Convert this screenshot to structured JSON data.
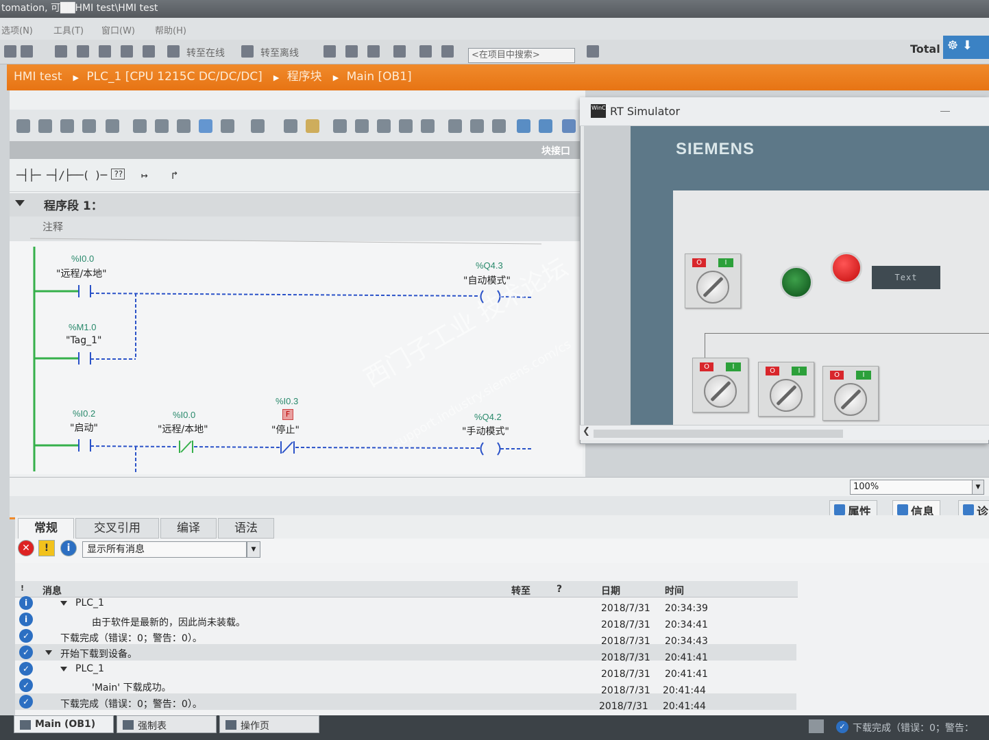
{
  "window": {
    "title": "tomation,  可██HMI test\\HMI test"
  },
  "menu": [
    {
      "label": "选项(N)"
    },
    {
      "label": "工具(T)"
    },
    {
      "label": "窗口(W)"
    },
    {
      "label": "帮助(H)"
    }
  ],
  "toolbar": {
    "go_online": "转至在线",
    "go_offline": "转至离线",
    "search_placeholder": "<在项目中搜索>",
    "total": "Total"
  },
  "breadcrumb": [
    "HMI test",
    "PLC_1 [CPU 1215C DC/DC/DC]",
    "程序块",
    "Main [OB1]"
  ],
  "editor": {
    "interface_label": "块接口",
    "ladder_tools": [
      "─┤├─",
      "─┤/├─",
      "─( )─",
      "??",
      "↦",
      "↱"
    ],
    "network_title": "程序段 1：",
    "comment": "注释",
    "rungs": [
      {
        "contacts": [
          {
            "address": "%I0.0",
            "tag": "\"远程/本地\""
          },
          {
            "address": "%M1.0",
            "tag": "\"Tag_1\""
          }
        ],
        "coil": {
          "address": "%Q4.3",
          "tag": "\"自动模式\""
        }
      },
      {
        "contacts": [
          {
            "address": "%I0.2",
            "tag": "\"启动\""
          },
          {
            "address": "%I0.0",
            "tag": "\"远程/本地\""
          },
          {
            "address": "%I0.3",
            "tag": "\"停止\"",
            "flag": "F"
          }
        ],
        "coil": {
          "address": "%Q4.2",
          "tag": "\"手动模式\""
        }
      }
    ]
  },
  "simulator": {
    "title": "RT Simulator",
    "brand": "SIEMENS",
    "switch_labels": {
      "off": "O",
      "on": "I"
    },
    "text_field": "Text",
    "colors": {
      "lamp": "#1e7a2c",
      "button": "#e21b1b",
      "panel": "#5d7888"
    }
  },
  "zoom": "100%",
  "inspector": {
    "tabs_right": [
      "属性",
      "信息",
      "诊"
    ],
    "tabs": [
      "常规",
      "交叉引用",
      "编译",
      "语法"
    ],
    "filter": "显示所有消息",
    "columns": {
      "message": "消息",
      "goto": "转至",
      "q": "?",
      "date": "日期",
      "time": "时间"
    },
    "rows": [
      {
        "icon": "i",
        "indent": 1,
        "caret": true,
        "text": "PLC_1",
        "date": "2018/7/31",
        "time": "20:34:39"
      },
      {
        "icon": "i",
        "indent": 2,
        "caret": false,
        "text": "由于软件是最新的，因此尚未装载。",
        "date": "2018/7/31",
        "time": "20:34:41"
      },
      {
        "icon": "✓",
        "indent": 0,
        "caret": false,
        "text": "下载完成（错误：0；警告：0）。",
        "date": "2018/7/31",
        "time": "20:34:43"
      },
      {
        "icon": "✓",
        "indent": 0,
        "caret": true,
        "text": "开始下载到设备。",
        "date": "2018/7/31",
        "time": "20:41:41",
        "hl": true
      },
      {
        "icon": "✓",
        "indent": 1,
        "caret": true,
        "text": "PLC_1",
        "date": "2018/7/31",
        "time": "20:41:41"
      },
      {
        "icon": "✓",
        "indent": 2,
        "caret": false,
        "text": "'Main' 下载成功。",
        "date": "2018/7/31",
        "time": "20:41:44"
      },
      {
        "icon": "✓",
        "indent": 0,
        "caret": false,
        "text": "下载完成（错误：0；警告：0）。",
        "date": "2018/7/31",
        "time": "20:41:44",
        "hl": true
      }
    ]
  },
  "statusbar": {
    "tabs": [
      "Main (OB1)",
      "强制表",
      "操作页"
    ],
    "status": "下载完成（错误：0；警告："
  },
  "watermark": {
    "text": "西门子工业 技术论坛",
    "url": "support.industry.siemens.com/cs"
  }
}
